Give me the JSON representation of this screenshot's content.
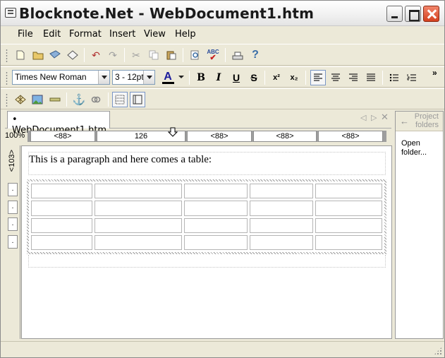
{
  "window": {
    "title": "Blocknote.Net - WebDocument1.htm"
  },
  "menu": [
    "File",
    "Edit",
    "Format",
    "Insert",
    "View",
    "Help"
  ],
  "toolbar_main": {
    "icons": [
      "new-document-icon",
      "open-icon",
      "save-icon",
      "save-as-icon",
      "undo-icon",
      "redo-icon",
      "cut-icon",
      "copy-icon",
      "paste-icon",
      "find-icon",
      "spellcheck-icon",
      "print-icon",
      "help-icon"
    ],
    "spellcheck_label": "ABC",
    "help_glyph": "?"
  },
  "toolbar_format": {
    "font_name": "Times New Roman",
    "font_size": "3 - 12pt",
    "font_color_glyph": "A",
    "font_color_hex": "#1c1c9c",
    "bold_glyph": "B",
    "italic_glyph": "I",
    "underline_glyph": "U",
    "strike_glyph": "S",
    "superscript_glyph": "x²",
    "subscript_glyph": "x₂",
    "overflow_glyph": "»"
  },
  "toolbar_table": {
    "icons": [
      "insert-table-icon",
      "insert-image-icon",
      "horizontal-line-icon",
      "anchor-icon",
      "hyperlink-icon",
      "show-grid-icon",
      "show-borders-icon"
    ]
  },
  "tabs": {
    "active_label": "WebDocument1.htm",
    "bullet": "•"
  },
  "ruler": {
    "zoom": "100%",
    "cells": [
      "<88>",
      "126",
      "<88>",
      "<88>",
      "<88>"
    ]
  },
  "vertical_ruler": {
    "label": "<103>",
    "rows": [
      ".",
      ".",
      ".",
      "."
    ]
  },
  "document": {
    "paragraph": "This is a paragraph and here comes a table:",
    "table_rows": 4,
    "table_cols": 5
  },
  "project_pane": {
    "title": "Project folders",
    "open_folder": "Open folder..."
  },
  "colors": {
    "chrome": "#ece9d8",
    "close_button": "#d4401e",
    "input_border": "#7f9db9"
  }
}
